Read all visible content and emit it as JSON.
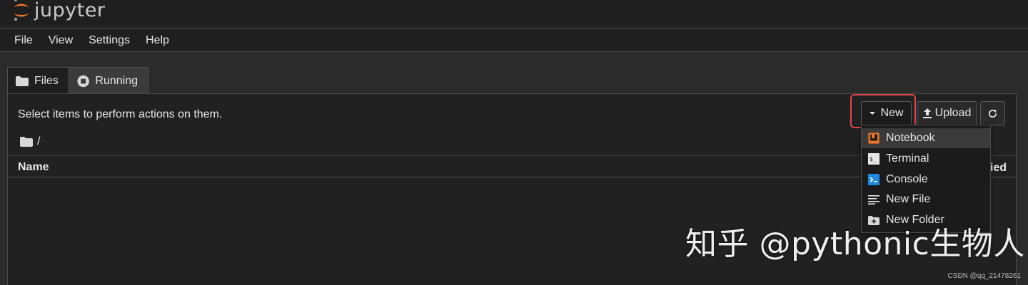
{
  "app": {
    "logo_text": "jupyter"
  },
  "menubar": {
    "items": [
      "File",
      "View",
      "Settings",
      "Help"
    ]
  },
  "tabs": [
    {
      "label": "Files",
      "icon": "folder-icon",
      "active": true
    },
    {
      "label": "Running",
      "icon": "stop-circle-icon",
      "active": false
    }
  ],
  "toolbar": {
    "hint": "Select items to perform actions on them.",
    "new_label": "New",
    "upload_label": "Upload"
  },
  "breadcrumb": {
    "path": "/"
  },
  "table": {
    "columns": [
      "Name",
      "Last Modified"
    ],
    "visible_modified_suffix": "ied"
  },
  "dropdown": {
    "items": [
      {
        "label": "Notebook",
        "icon": "notebook-icon",
        "selected": true
      },
      {
        "label": "Terminal",
        "icon": "terminal-icon",
        "selected": false
      },
      {
        "label": "Console",
        "icon": "console-icon",
        "selected": false
      },
      {
        "label": "New File",
        "icon": "text-file-icon",
        "selected": false
      },
      {
        "label": "New Folder",
        "icon": "new-folder-icon",
        "selected": false
      }
    ]
  },
  "overlay": {
    "watermark": "知乎 @pythonic生物人",
    "credit": "CSDN @qq_21478261"
  },
  "colors": {
    "accent_orange": "#f37726",
    "highlight_red": "#e04848",
    "console_blue": "#1e88e5"
  }
}
